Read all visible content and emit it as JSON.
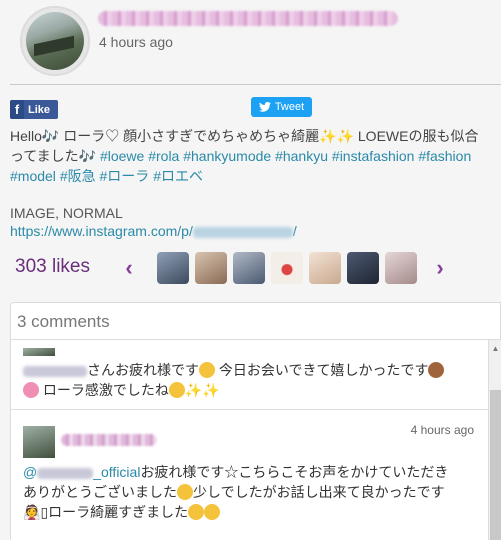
{
  "post": {
    "time": "4 hours ago",
    "share": {
      "like_label": "Like",
      "tweet_label": "Tweet"
    },
    "caption": {
      "text1": "Hello🎶 ローラ♡ 顔小さすぎでめちゃめちゃ綺麗",
      "text2": " LOEWEの服も似合ってました",
      "tags": [
        "#loewe",
        "#rola",
        "#hankyumode",
        "#hankyu",
        "#instafashion",
        "#fashion",
        "#model",
        "#阪急",
        "#ローラ",
        "#ロエベ"
      ]
    },
    "media_type": "IMAGE, NORMAL",
    "link_prefix": "https://www.instagram.com/p/",
    "link_suffix": "/"
  },
  "likes": {
    "label": "303 likes",
    "prev_icon": "chevron-left-icon",
    "next_icon": "chevron-right-icon"
  },
  "comments": {
    "title": "3 comments",
    "items": [
      {
        "text1": "さんお疲れ様です",
        "text2": " 今日お会いできて嬉しかったです",
        "text3": " ローラ感激でしたね"
      },
      {
        "time": "4 hours ago",
        "mention_suffix": "_official",
        "text1": "お疲れ様です☆こちらこそお声をかけていただき",
        "text2": "ありがとうございました",
        "text3": "少しでしたがお話し出来て良かったです",
        "text4": "ローラ綺麗すぎました"
      }
    ]
  },
  "colors": {
    "accent_purple": "#6a2e7c",
    "hashtag": "#2a8aa8",
    "facebook": "#3b5998",
    "twitter": "#1da1f2"
  }
}
